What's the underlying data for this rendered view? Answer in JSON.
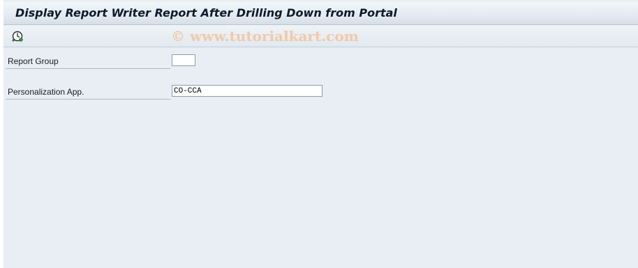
{
  "window": {
    "title": "Display Report Writer Report After Drilling Down from Portal"
  },
  "toolbar": {
    "execute_icon": "execute-clock-icon",
    "watermark": "© www.tutorialkart.com"
  },
  "form": {
    "report_group": {
      "label": "Report Group",
      "value": ""
    },
    "personalization_app": {
      "label": "Personalization App.",
      "value": "CO-CCA"
    }
  },
  "colors": {
    "background": "#e8eef4",
    "title_text": "#0d1b2a",
    "watermark": "#f2c9a8"
  }
}
